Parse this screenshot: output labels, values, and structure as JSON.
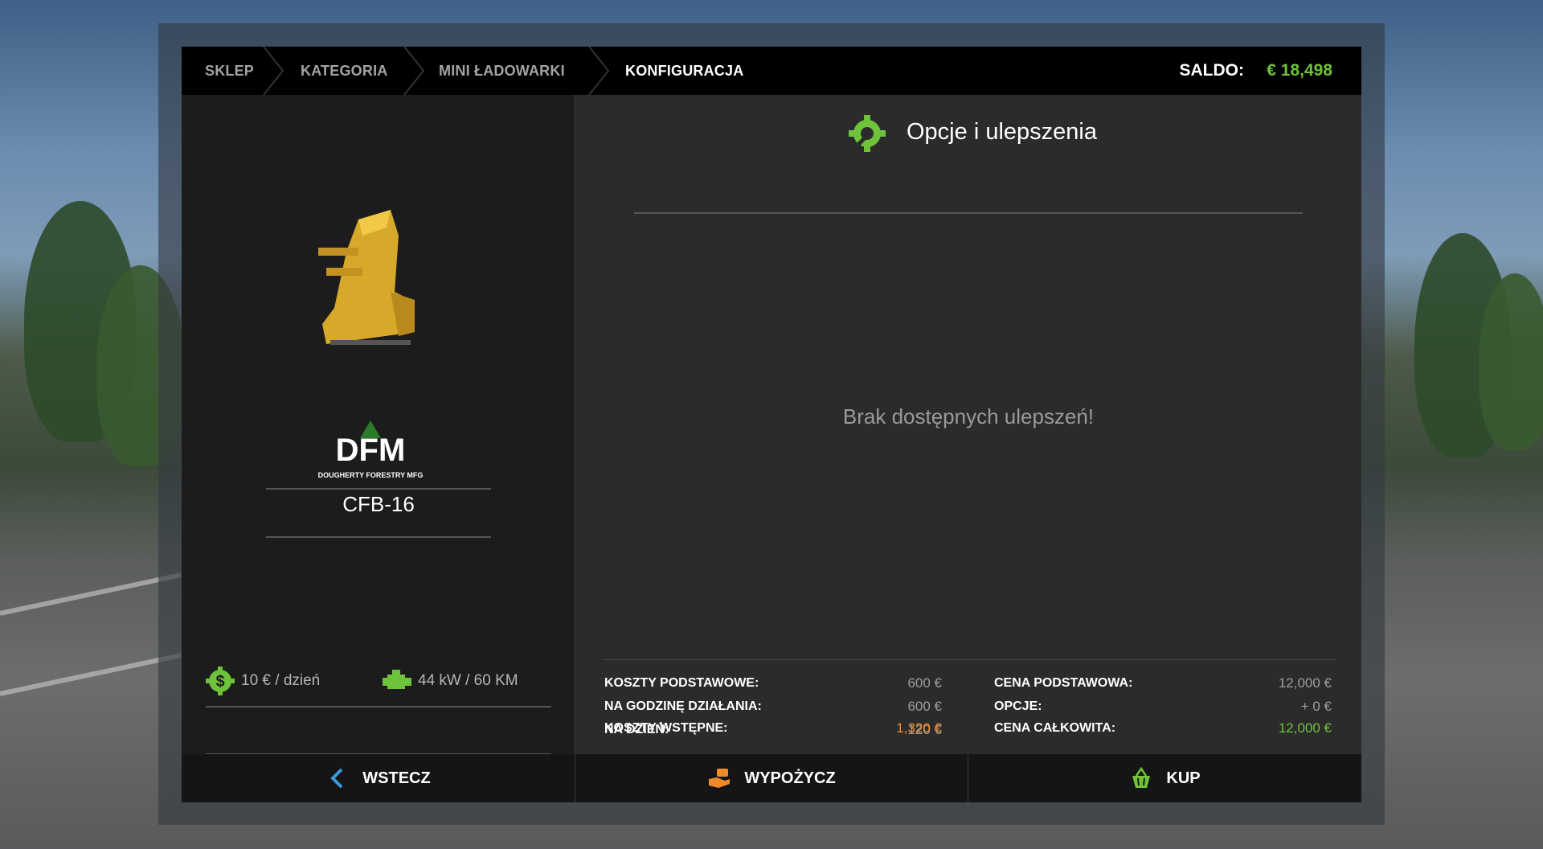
{
  "breadcrumb": {
    "items": [
      "SKLEP",
      "KATEGORIA",
      "MINI ŁADOWARKI",
      "KONFIGURACJA"
    ]
  },
  "balance": {
    "label": "SALDO:",
    "value": "€ 18,498"
  },
  "product": {
    "brand_logo_text": "DFM",
    "brand_subtitle": "DOUGHERTY FORESTRY MFG",
    "name": "CFB-16",
    "stats": {
      "daily_cost": "10 € / dzień",
      "power": "44 kW / 60 KM"
    }
  },
  "options": {
    "title": "Opcje i ulepszenia",
    "empty_message": "Brak dostępnych ulepszeń!"
  },
  "costs": {
    "left": [
      {
        "label": "KOSZTY PODSTAWOWE:",
        "value": "600 €"
      },
      {
        "label": "NA GODZINĘ DZIAŁANIA:",
        "value": "600 €"
      },
      {
        "label": "NA DZIEŃ:",
        "value": "120 €"
      }
    ],
    "left_total": {
      "label": "KOSZTY WSTĘPNE:",
      "value": "1,320 €"
    },
    "right": [
      {
        "label": "CENA PODSTAWOWA:",
        "value": "12,000 €"
      },
      {
        "label": "OPCJE:",
        "value": "+ 0 €"
      }
    ],
    "right_total": {
      "label": "CENA CAŁKOWITA:",
      "value": "12,000 €"
    }
  },
  "buttons": {
    "back": "WSTECZ",
    "lease": "WYPOŻYCZ",
    "buy": "KUP"
  },
  "colors": {
    "accent_green": "#6fc33a",
    "accent_orange": "#f0892c",
    "back_blue": "#3a9ad9"
  },
  "icons": {
    "options": "wrench-gear-icon",
    "daily_cost": "dollar-gear-icon",
    "power": "engine-icon",
    "back": "chevron-left-icon",
    "lease": "hand-money-icon",
    "buy": "basket-icon"
  }
}
